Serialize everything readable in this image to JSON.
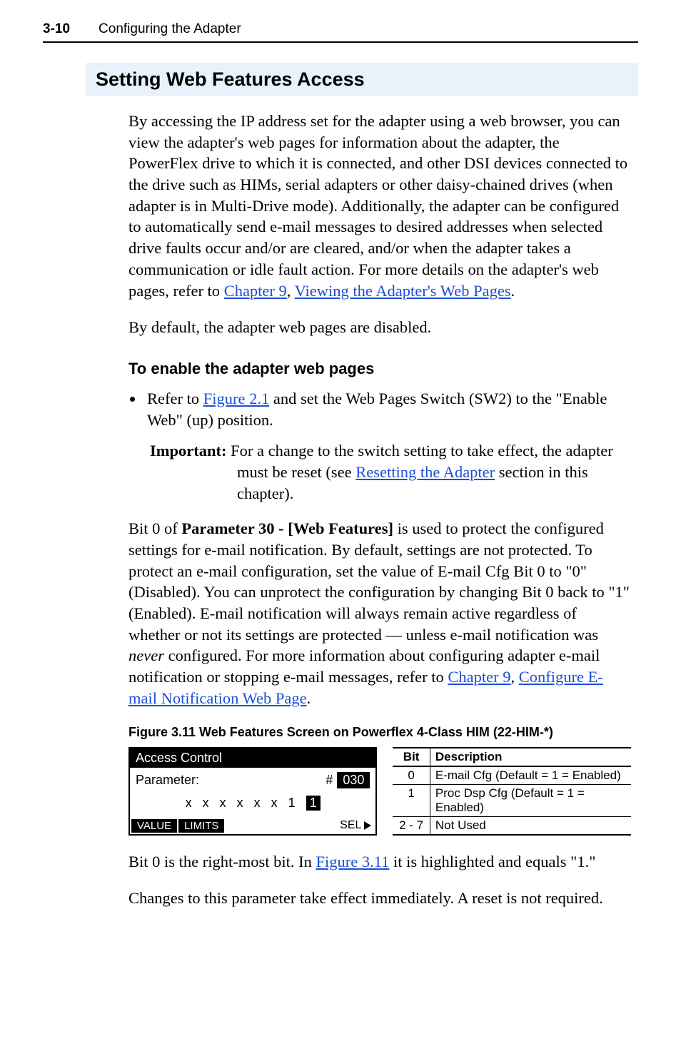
{
  "header": {
    "page_number": "3-10",
    "chapter_title": "Configuring the Adapter"
  },
  "section": {
    "title": "Setting Web Features Access"
  },
  "intro": {
    "p1_a": "By accessing the IP address set for the adapter using a web browser, you can view the adapter's web pages for information about the adapter, the PowerFlex drive to which it is connected, and other DSI devices connected to the drive such as HIMs, serial adapters or other daisy-chained drives (when adapter is in Multi-Drive mode). Additionally, the adapter can be configured to automatically send e-mail messages to desired addresses when selected drive faults occur and/or are cleared, and/or when the adapter takes a communication or idle fault action. For more details on the adapter's web pages, refer to ",
    "link_ch9": "Chapter 9",
    "p1_b": ", ",
    "link_view": "Viewing the Adapter's Web Pages",
    "p1_c": ".",
    "p2": "By default, the adapter web pages are disabled."
  },
  "enable": {
    "heading": "To enable the adapter web pages",
    "bullet_a": "Refer to ",
    "bullet_link": "Figure 2.1",
    "bullet_b": " and set the Web Pages Switch (SW2) to the \"Enable Web\" (up) position.",
    "important_label": "Important:",
    "important_a": "For a change to the switch setting to take effect, the adapter must be reset (see ",
    "important_link": "Resetting the Adapter",
    "important_b": " section in this chapter)."
  },
  "bit0": {
    "a": "Bit 0 of ",
    "param_bold": "Parameter 30 - [Web Features]",
    "b": " is used to protect the configured settings for e-mail notification. By default, settings are not protected. To protect an e-mail configuration, set the value of E-mail Cfg Bit 0 to \"0\" (Disabled). You can unprotect the configuration by changing Bit 0 back to \"1\" (Enabled). E-mail notification will always remain active regardless of whether or not its settings are protected — unless e-mail notification was ",
    "never_italic": "never",
    "c": " configured. For more information about configuring adapter e-mail notification or stopping e-mail messages, refer to ",
    "link_ch9": "Chapter 9",
    "d": ", ",
    "link_cfg": "Configure E-mail Notification Web Page",
    "e": "."
  },
  "figure": {
    "caption": "Figure 3.11   Web Features Screen on Powerflex 4-Class HIM (22-HIM-*)",
    "him_title": "Access Control",
    "param_label": "Parameter:",
    "hash": "#",
    "param_num": "030",
    "bits_prefix": "x x x x x x 1",
    "bit_hl": "1",
    "btn_value": "VALUE",
    "btn_limits": "LIMITS",
    "sel_label": "SEL"
  },
  "bit_table": {
    "h_bit": "Bit",
    "h_desc": "Description",
    "rows": [
      {
        "bit": "0",
        "desc": "E-mail Cfg (Default = 1 = Enabled)"
      },
      {
        "bit": "1",
        "desc": "Proc Dsp Cfg (Default = 1 = Enabled)"
      },
      {
        "bit": "2 - 7",
        "desc": "Not Used"
      }
    ]
  },
  "tail": {
    "p1_a": "Bit 0 is the right-most bit. In ",
    "p1_link": "Figure 3.11",
    "p1_b": " it is highlighted and equals \"1.\"",
    "p2": "Changes to this parameter take effect immediately. A reset is not required."
  }
}
